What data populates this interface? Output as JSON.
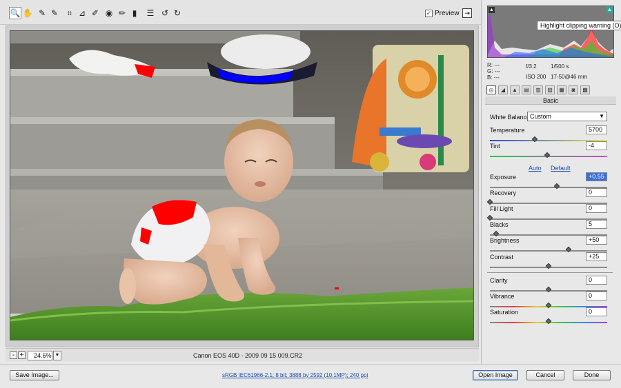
{
  "toolbar": {
    "tools": [
      {
        "name": "zoom-tool",
        "glyph": "🔍"
      },
      {
        "name": "hand-tool",
        "glyph": "✋"
      },
      {
        "name": "white-balance-tool",
        "glyph": "✎"
      },
      {
        "name": "color-sampler-tool",
        "glyph": "✎"
      },
      {
        "name": "crop-tool",
        "glyph": "⌗"
      },
      {
        "name": "straighten-tool",
        "glyph": "⊿"
      },
      {
        "name": "spot-removal-tool",
        "glyph": "✐"
      },
      {
        "name": "red-eye-tool",
        "glyph": "◉"
      },
      {
        "name": "adjustment-brush-tool",
        "glyph": "✏"
      },
      {
        "name": "graduated-filter-tool",
        "glyph": "▮"
      },
      {
        "name": "preferences-tool",
        "glyph": "☰"
      },
      {
        "name": "rotate-left-tool",
        "glyph": "↺"
      },
      {
        "name": "rotate-right-tool",
        "glyph": "↻"
      }
    ],
    "preview_label": "Preview",
    "preview_checked": "✓",
    "fullscreen_glyph": "⇥"
  },
  "status": {
    "zoom_minus": "-",
    "zoom_plus": "+",
    "zoom_value": "24.6%",
    "zoom_dropdown": "▼",
    "caption": "Canon EOS 40D  -  2009 09 15 009.CR2"
  },
  "histogram": {
    "tooltip": "Highlight clipping warning (O)",
    "shadow_clip": "▲",
    "highlight_clip": "▲"
  },
  "readout": {
    "r": "R:  ---",
    "g": "G:  ---",
    "b": "B:  ---",
    "aperture": "f/3.2",
    "shutter": "1/500 s",
    "iso": "ISO 200",
    "lens": "17-50@46 mm"
  },
  "panel": {
    "tabs": [
      "◎",
      "◢",
      "▲",
      "▤",
      "▥",
      "▧",
      "▦",
      "◙",
      "▩"
    ],
    "title": "Basic",
    "white_balance_label": "White Balance:",
    "white_balance_value": "Custom",
    "white_balance_arrow": "▼",
    "auto_label": "Auto",
    "default_label": "Default",
    "sliders": [
      {
        "label": "Temperature",
        "value": "5700",
        "position": 0.38,
        "track": "temperature"
      },
      {
        "label": "Tint",
        "value": "-4",
        "position": 0.49,
        "track": "tint"
      },
      {
        "label": "Exposure",
        "value": "+0.55",
        "position": 0.57,
        "track": "gray",
        "highlight": true
      },
      {
        "label": "Recovery",
        "value": "0",
        "position": 0.0,
        "track": "gray"
      },
      {
        "label": "Fill Light",
        "value": "0",
        "position": 0.0,
        "track": "gray"
      },
      {
        "label": "Blacks",
        "value": "5",
        "position": 0.05,
        "track": "gray"
      },
      {
        "label": "Brightness",
        "value": "+50",
        "position": 0.67,
        "track": "gray"
      },
      {
        "label": "Contrast",
        "value": "+25",
        "position": 0.5,
        "track": "gray"
      },
      {
        "label": "Clarity",
        "value": "0",
        "position": 0.5,
        "track": "gray"
      },
      {
        "label": "Vibrance",
        "value": "0",
        "position": 0.5,
        "track": "rainbow"
      },
      {
        "label": "Saturation",
        "value": "0",
        "position": 0.5,
        "track": "rainbow"
      }
    ]
  },
  "bottom": {
    "save_image": "Save Image...",
    "workflow": "sRGB IEC61966-2.1; 8 bit; 3888 by 2592 (10.1MP); 240 ppi",
    "open_image": "Open Image",
    "cancel": "Cancel",
    "done": "Done"
  },
  "colors": {
    "clipping_highlight": "#ff0000",
    "clipping_shadow": "#0000ff",
    "grass": "#4e9a2a",
    "concrete": "#9a9890"
  }
}
